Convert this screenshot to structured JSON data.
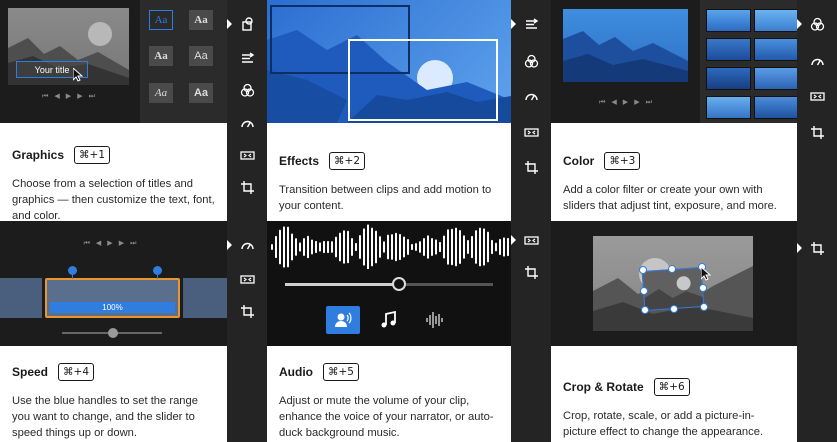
{
  "cards": {
    "graphics": {
      "title": "Graphics",
      "shortcut": "⌘+1",
      "desc": "Choose from a selection of titles and graphics — then customize the text, font, and color.",
      "preview_title": "Your title",
      "style_labels": [
        "Aa",
        "Aa",
        "Aa",
        "Aa",
        "Aa",
        "Aa"
      ]
    },
    "effects": {
      "title": "Effects",
      "shortcut": "⌘+2",
      "desc": "Transition between clips and add motion to your content."
    },
    "color": {
      "title": "Color",
      "shortcut": "⌘+3",
      "desc": "Add a color filter or create your own with sliders that adjust tint, exposure, and more."
    },
    "speed": {
      "title": "Speed",
      "shortcut": "⌘+4",
      "desc": "Use the blue handles to set the range you want to change, and the slider to speed things up or down.",
      "range_label": "100%"
    },
    "audio": {
      "title": "Audio",
      "shortcut": "⌘+5",
      "desc": "Adjust or mute the volume of your clip, enhance the voice of your narrator, or auto-duck background music.",
      "volume_level": 0.55
    },
    "crop": {
      "title": "Crop & Rotate",
      "shortcut": "⌘+6",
      "desc": "Crop, rotate, scale, or add a picture-in-picture effect to change the appearance."
    }
  },
  "playback_controls": [
    "⏮",
    "◀",
    "▶",
    "▶",
    "⏭"
  ],
  "icons": {
    "graphics": "graphics-shape-icon",
    "effects": "transition-icon",
    "color": "color-circles-icon",
    "speed": "speed-gauge-icon",
    "audio": "audio-waveform-icon",
    "crop": "crop-icon"
  },
  "colors": {
    "accent": "#2f7dde",
    "speed_handle": "#e8962e"
  }
}
